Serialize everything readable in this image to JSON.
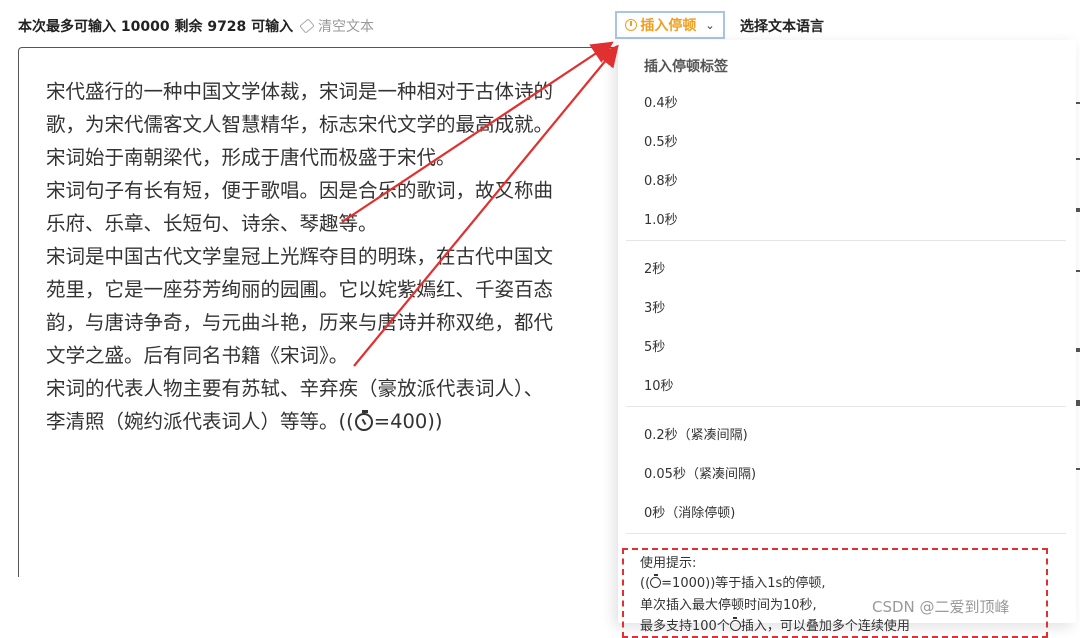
{
  "toolbar": {
    "counter": "本次最多可输入 10000 剩余 9728 可输入",
    "clear_label": "清空文本",
    "insert_pause_label": "插入停顿",
    "select_language_label": "选择文本语言"
  },
  "editor": {
    "paragraphs": [
      "宋代盛行的一种中国文学体裁，宋词是一种相对于古体诗的",
      "歌，为宋代儒客文人智慧精华，标志宋代文学的最高成就。",
      "宋词始于南朝梁代，形成于唐代而极盛于宋代。",
      "宋词句子有长有短，便于歌唱。因是合乐的歌词，故又称曲",
      "乐府、乐章、长短句、诗余、琴趣等。",
      "宋词是中国古代文学皇冠上光辉夺目的明珠，在古代中国文",
      "苑里，它是一座芬芳绚丽的园圃。它以姹紫嫣红、千姿百态",
      "韵，与唐诗争奇，与元曲斗艳，历来与唐诗并称双绝，都代",
      "文学之盛。后有同名书籍《宋词》。",
      "宋词的代表人物主要有苏轼、辛弃疾（豪放派代表词人）、",
      "李清照（婉约派代表词人）等等。"
    ],
    "pause_tag_prefix": "((",
    "pause_tag_suffix": "=400))"
  },
  "dropdown": {
    "header": "插入停顿标签",
    "group1": [
      "0.4秒",
      "0.5秒",
      "0.8秒",
      "1.0秒"
    ],
    "group2": [
      "2秒",
      "3秒",
      "5秒",
      "10秒"
    ],
    "group3": [
      "0.2秒（紧凑间隔)",
      "0.05秒（紧凑间隔)",
      "0秒（消除停顿)"
    ],
    "tips": {
      "title": "使用提示:",
      "line1_prefix": "((",
      "line1_suffix": "=1000))等于插入1s的停顿,",
      "line2": "单次插入最大停顿时间为10秒,",
      "line3_prefix": "最多支持100个",
      "line3_suffix": "插入，可以叠加多个连续使用"
    }
  },
  "watermark": "CSDN @二爱到顶峰",
  "colors": {
    "accent_orange": "#f0a020",
    "annotation_red": "#e03030",
    "button_border": "#a8c4e6"
  },
  "icons": {
    "timer": "stopwatch-icon",
    "clear": "eraser-icon",
    "dropdown": "chevron-down-icon"
  }
}
